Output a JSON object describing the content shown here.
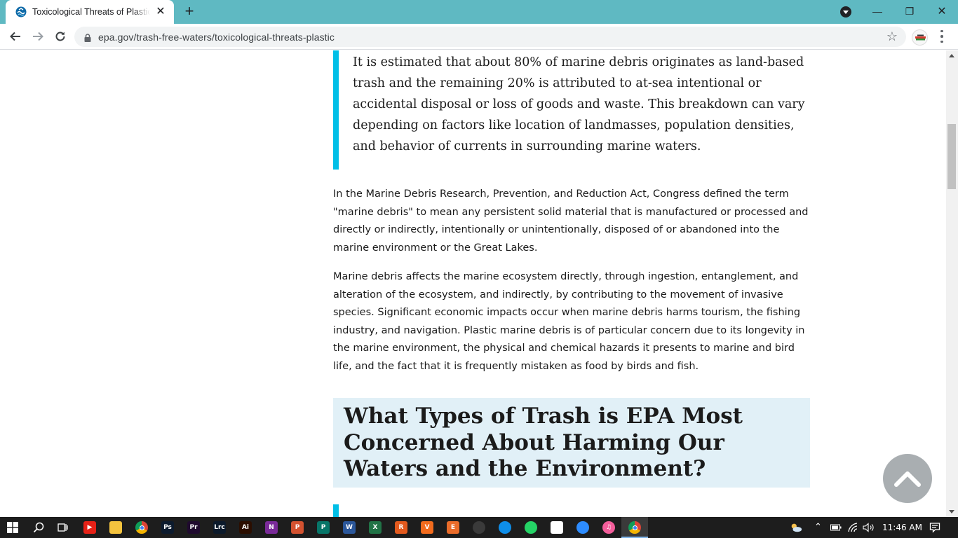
{
  "browser": {
    "tab_title": "Toxicological Threats of Plastic | US EPA",
    "tab_close_glyph": "✕",
    "new_tab_glyph": "+",
    "url": "epa.gov/trash-free-waters/toxicological-threats-plastic",
    "star_glyph": "☆",
    "window_controls": {
      "minimize": "—",
      "restore": "❐",
      "close": "✕"
    }
  },
  "page": {
    "callout_text": "It is estimated that about 80% of marine debris originates as land-based trash and the remaining 20% is attributed to at-sea intentional or accidental disposal or loss of goods and waste. This breakdown can vary depending on factors like location of landmasses, population densities, and behavior of currents in surrounding marine waters.",
    "paragraph_1": "In the Marine Debris Research, Prevention, and Reduction Act, Congress defined the term \"marine debris\" to mean any persistent solid material that is manufactured or processed and directly or indirectly, intentionally or unintentionally, disposed of or abandoned into the marine environment or the Great Lakes.",
    "paragraph_2": "Marine debris affects the marine ecosystem directly, through ingestion, entanglement, and alteration of the ecosystem, and indirectly, by contributing to the movement of invasive species. Significant economic impacts occur when marine debris harms tourism, the fishing industry, and navigation. Plastic marine debris is of particular concern due to its longevity in the marine environment, the physical and chemical hazards it presents to marine and bird life, and the fact that it is frequently mistaken as food by birds and fish.",
    "section_heading": "What Types of Trash is EPA Most Concerned About Harming Our Waters and the Environment?"
  },
  "taskbar": {
    "apps": [
      {
        "name": "youtube-icon",
        "label": "▶",
        "color": "#e62117"
      },
      {
        "name": "file-explorer-icon",
        "label": "",
        "color": "#f4c33e"
      },
      {
        "name": "chrome-icon",
        "label": "",
        "color": "#e8b600"
      },
      {
        "name": "photoshop-icon",
        "label": "Ps",
        "color": "#0d1b2e"
      },
      {
        "name": "premiere-icon",
        "label": "Pr",
        "color": "#1f0a2e"
      },
      {
        "name": "lightroom-classic-icon",
        "label": "Lrc",
        "color": "#0c1a2b"
      },
      {
        "name": "illustrator-icon",
        "label": "Ai",
        "color": "#2b0e00"
      },
      {
        "name": "onenote-icon",
        "label": "N",
        "color": "#7a2b99"
      },
      {
        "name": "powerpoint-icon",
        "label": "P",
        "color": "#d35230"
      },
      {
        "name": "publisher-icon",
        "label": "P",
        "color": "#077568"
      },
      {
        "name": "word-icon",
        "label": "W",
        "color": "#2b579a"
      },
      {
        "name": "excel-icon",
        "label": "X",
        "color": "#217346"
      },
      {
        "name": "app-r-icon",
        "label": "R",
        "color": "#e35a1e"
      },
      {
        "name": "app-v-icon",
        "label": "V",
        "color": "#f26b1d"
      },
      {
        "name": "app-e-icon",
        "label": "E",
        "color": "#ea6c2a"
      },
      {
        "name": "obs-icon",
        "label": "",
        "color": "#3a3a3a"
      },
      {
        "name": "teamviewer-icon",
        "label": "",
        "color": "#0e8ee9"
      },
      {
        "name": "whatsapp-icon",
        "label": "",
        "color": "#25d366"
      },
      {
        "name": "slack-icon",
        "label": "",
        "color": "#ffffff"
      },
      {
        "name": "zoom-icon",
        "label": "",
        "color": "#2d8cff"
      },
      {
        "name": "itunes-icon",
        "label": "♫",
        "color": "#f45e9b"
      },
      {
        "name": "chrome-active-icon",
        "label": "",
        "color": "#e8b600"
      }
    ],
    "clock": "11:46 AM",
    "accent_color": "#5fb9c2"
  }
}
